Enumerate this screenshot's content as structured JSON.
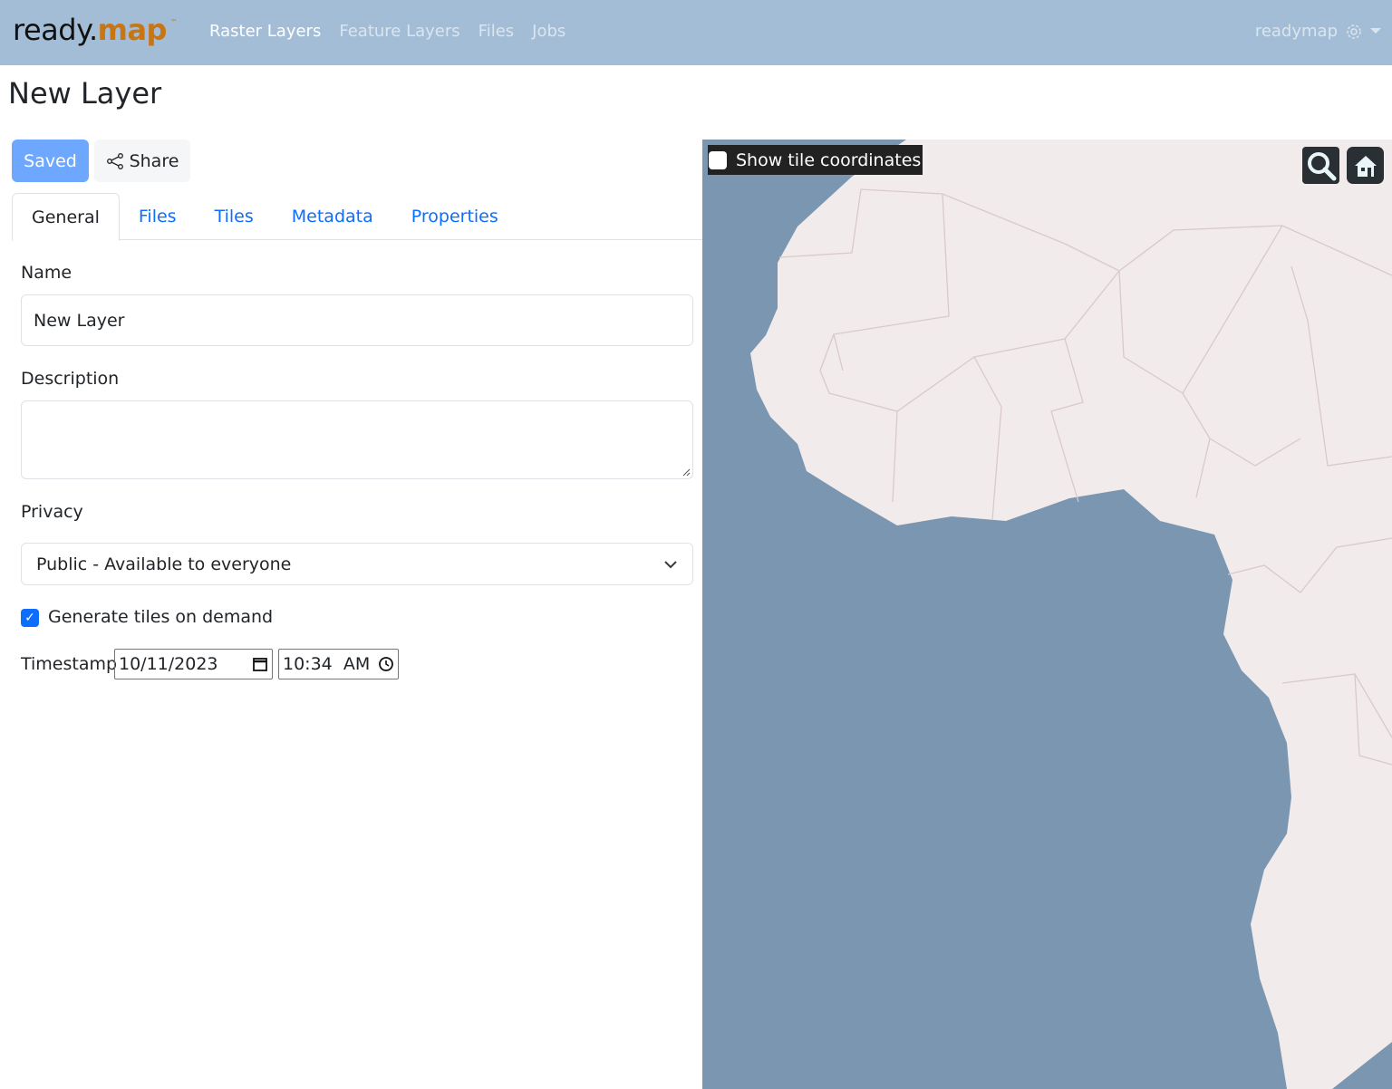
{
  "nav": {
    "logo_ready": "ready.",
    "logo_map": "map",
    "logo_tm": "™",
    "links": [
      {
        "label": "Raster Layers",
        "active": true
      },
      {
        "label": "Feature Layers",
        "active": false
      },
      {
        "label": "Files",
        "active": false
      },
      {
        "label": "Jobs",
        "active": false
      }
    ],
    "user": "readymap",
    "user_icon": "gear-icon"
  },
  "page": {
    "title": "New Layer"
  },
  "toolbar": {
    "saved_label": "Saved",
    "share_label": "Share"
  },
  "tabs": [
    {
      "label": "General",
      "active": true
    },
    {
      "label": "Files",
      "active": false
    },
    {
      "label": "Tiles",
      "active": false
    },
    {
      "label": "Metadata",
      "active": false
    },
    {
      "label": "Properties",
      "active": false
    }
  ],
  "form": {
    "name_label": "Name",
    "name_value": "New Layer",
    "description_label": "Description",
    "description_value": "",
    "privacy_label": "Privacy",
    "privacy_value": "Public - Available to everyone",
    "generate_label": "Generate tiles on demand",
    "generate_checked": true,
    "timestamp_label": "Timestamp",
    "date_value": "10/11/2023",
    "time_value": "10:34  AM"
  },
  "map": {
    "show_tile_coordinates_label": "Show tile coordinates",
    "show_tile_coordinates_checked": false,
    "ocean_color": "#7a96b0",
    "land_color": "#f2ebeb"
  }
}
